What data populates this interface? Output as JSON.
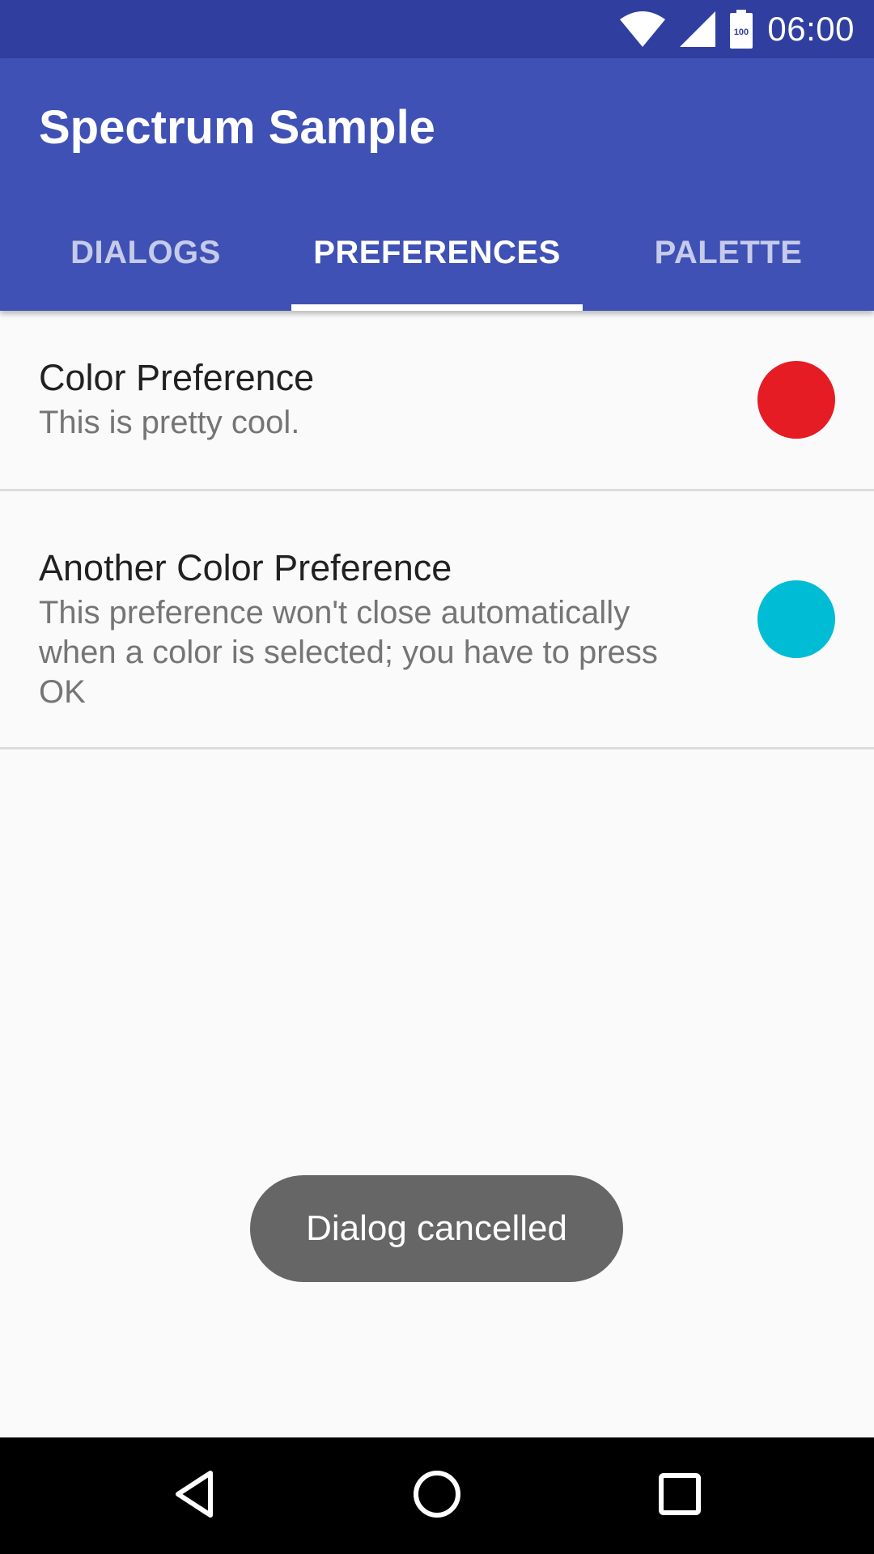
{
  "status_bar": {
    "time": "06:00",
    "battery_level": "100",
    "icons": [
      "wifi-icon",
      "cell-signal-icon",
      "battery-icon"
    ]
  },
  "app_bar": {
    "title": "Spectrum Sample",
    "color": "#3f51b5",
    "status_color": "#303f9f"
  },
  "tabs": [
    {
      "label": "DIALOGS",
      "selected": false
    },
    {
      "label": "PREFERENCES",
      "selected": true
    },
    {
      "label": "PALETTE",
      "selected": false
    }
  ],
  "preferences": [
    {
      "title": "Color Preference",
      "summary": "This is pretty cool.",
      "color": "#e51c23"
    },
    {
      "title": "Another Color Preference",
      "summary": "This preference won't close automatically when a color is selected; you have to press OK",
      "color": "#00bcd4"
    }
  ],
  "toast": {
    "message": "Dialog cancelled"
  },
  "nav_bar": {
    "buttons": [
      "back-icon",
      "home-icon",
      "recents-icon"
    ]
  }
}
